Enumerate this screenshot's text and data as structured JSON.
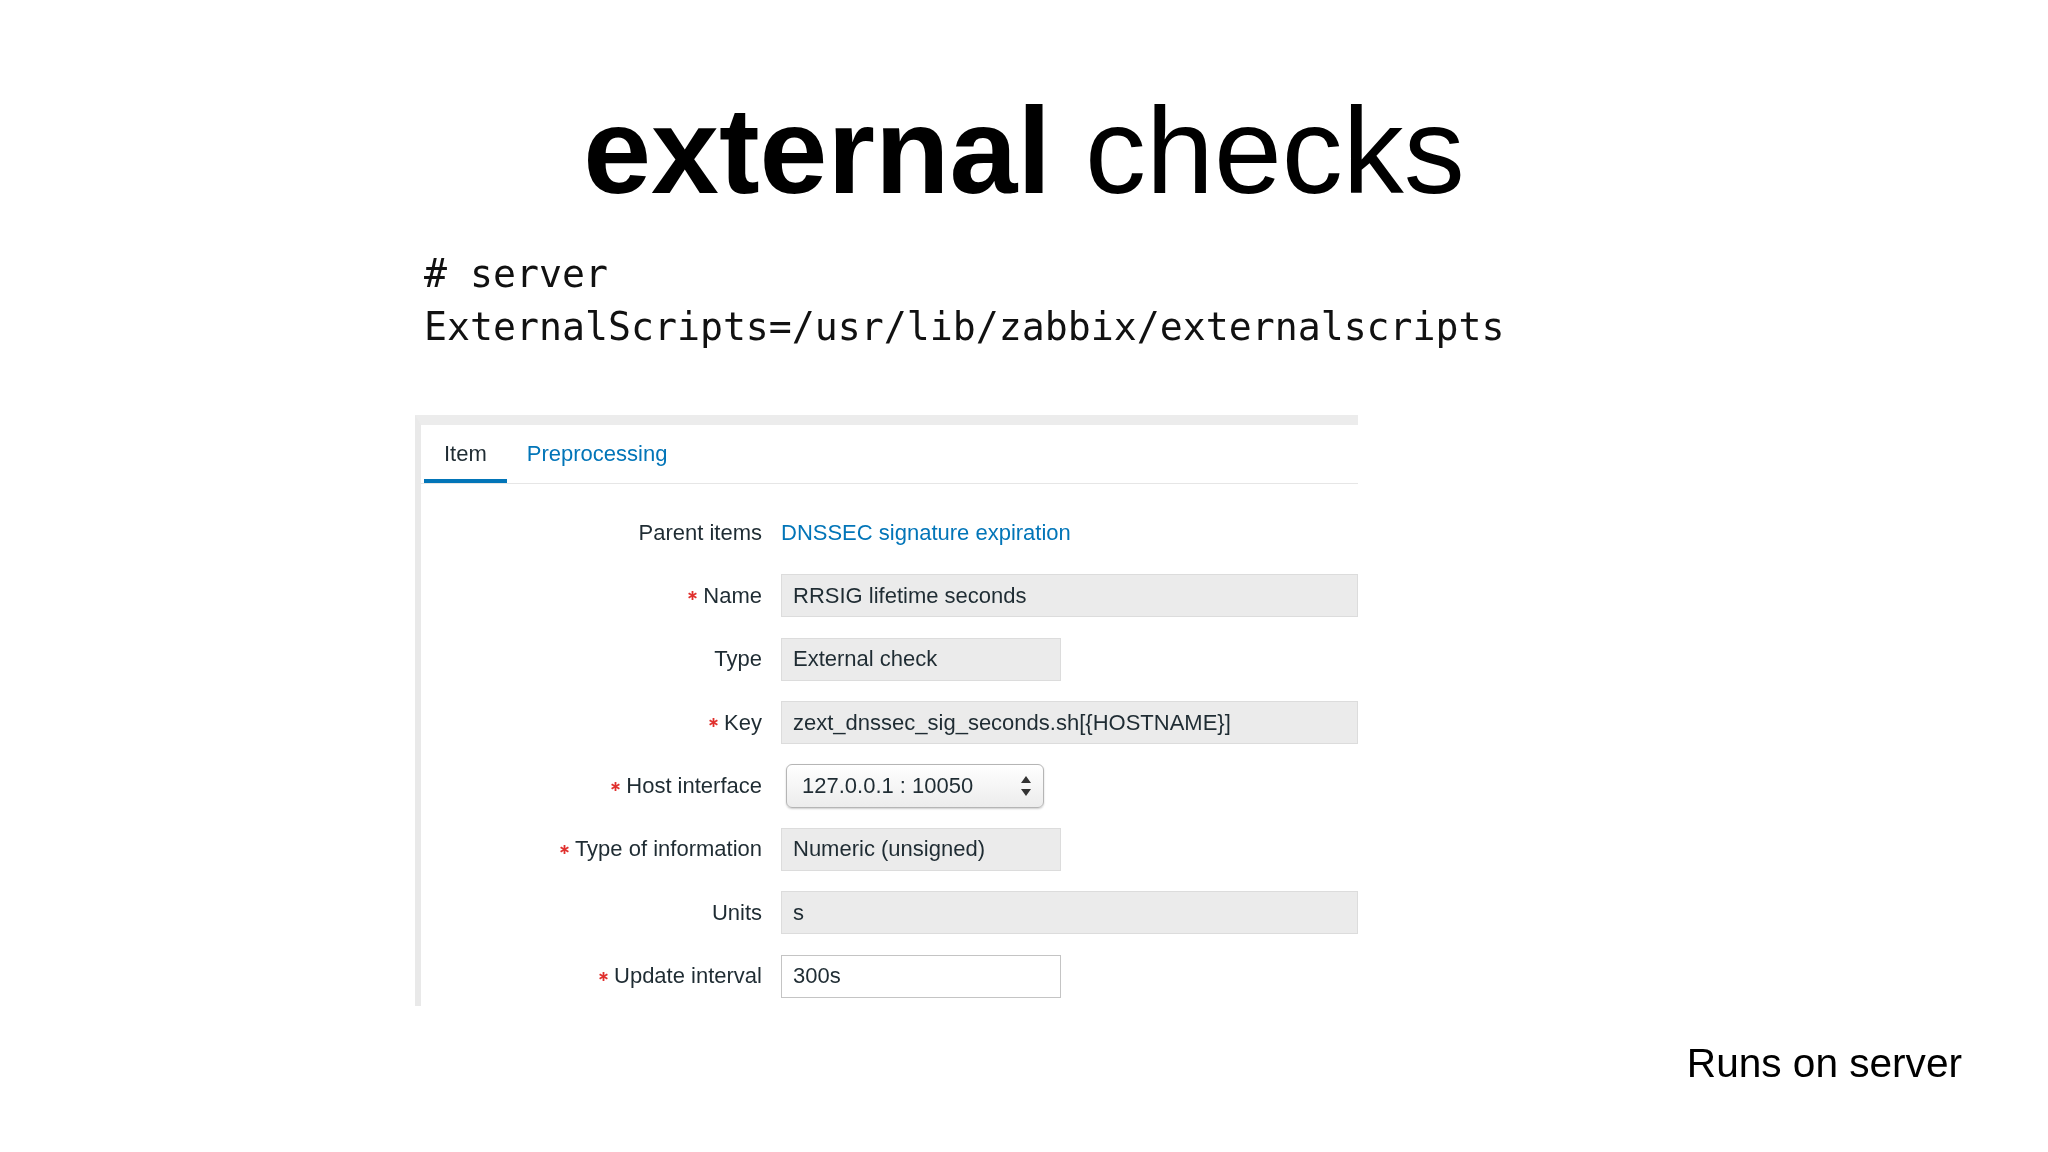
{
  "title": "**external** checks",
  "code": [
    "# server",
    "ExternalScripts=/usr/lib/zabbix/externalscripts"
  ],
  "form": {
    "tabs": [
      {
        "label": "Item",
        "selected": true
      },
      {
        "label": "Preprocessing",
        "selected": false
      }
    ],
    "fields": [
      {
        "label": "Parent items",
        "required": false,
        "kind": "link",
        "value": "DNSSEC signature expiration"
      },
      {
        "label": "Name",
        "required": true,
        "kind": "text",
        "readonly": true,
        "value": "RRSIG lifetime seconds"
      },
      {
        "label": "Type",
        "required": false,
        "kind": "select",
        "readonly": true,
        "value": "External check"
      },
      {
        "label": "Key",
        "required": true,
        "kind": "text",
        "readonly": true,
        "value": "zext_dnssec_sig_seconds.sh[{HOSTNAME}]"
      },
      {
        "label": "Host interface",
        "required": true,
        "kind": "select",
        "readonly": false,
        "value": "127.0.0.1 : 10050"
      },
      {
        "label": "Type of information",
        "required": true,
        "kind": "select",
        "readonly": true,
        "value": "Numeric (unsigned)"
      },
      {
        "label": "Units",
        "required": false,
        "kind": "text",
        "readonly": true,
        "value": "s"
      },
      {
        "label": "Update interval",
        "required": true,
        "kind": "short-text",
        "readonly": false,
        "value": "300s"
      }
    ]
  },
  "note": "Runs on server"
}
